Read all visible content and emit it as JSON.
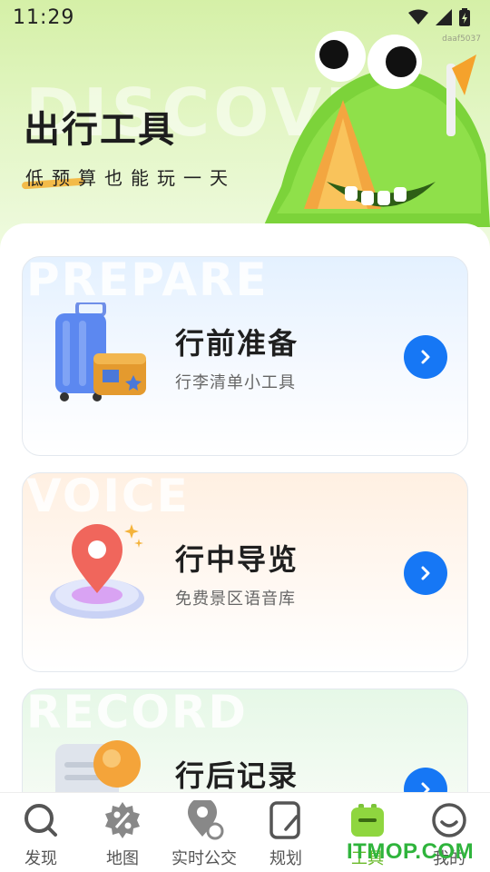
{
  "status_bar": {
    "time": "11:29",
    "device_code": "daaf5037"
  },
  "hero": {
    "watermark": "DISCOVE",
    "title": "出行工具",
    "subtitle": "低预算也能玩一天"
  },
  "cards": [
    {
      "watermark": "PREPARE",
      "title": "行前准备",
      "desc": "行李清单小工具"
    },
    {
      "watermark": "VOICE",
      "title": "行中导览",
      "desc": "免费景区语音库"
    },
    {
      "watermark": "RECORD",
      "title": "行后记录",
      "desc": ""
    }
  ],
  "nav": {
    "items": [
      {
        "label": "发现",
        "icon": "search-icon"
      },
      {
        "label": "地图",
        "icon": "map-gear-icon"
      },
      {
        "label": "实时公交",
        "icon": "location-pin-icon"
      },
      {
        "label": "规划",
        "icon": "notebook-icon"
      },
      {
        "label": "工具",
        "icon": "toolbox-icon",
        "active": true
      },
      {
        "label": "我的",
        "icon": "smiley-icon"
      }
    ]
  },
  "site_watermark": "ITMOP.COM",
  "colors": {
    "accent_green": "#6aba2a",
    "arrow_blue": "#1677f5",
    "hero_bg": "#d5f0a7"
  }
}
